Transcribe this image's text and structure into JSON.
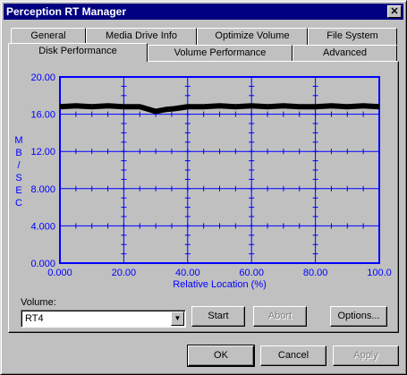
{
  "window": {
    "title": "Perception RT Manager",
    "close_glyph": "✕"
  },
  "tabs": {
    "back_row": [
      "General",
      "Media Drive Info",
      "Optimize Volume",
      "File System"
    ],
    "front_row": [
      "Disk Performance",
      "Volume Performance",
      "Advanced"
    ],
    "active": "Disk Performance"
  },
  "chart_data": {
    "type": "line",
    "xlabel": "Relative Location (%)",
    "ylabel": "MB/SEC",
    "xlim": [
      0,
      100
    ],
    "ylim": [
      0,
      20
    ],
    "x_ticks": [
      "0.000",
      "20.00",
      "40.00",
      "60.00",
      "80.00",
      "100.0"
    ],
    "y_ticks": [
      "0.000",
      "4.000",
      "8.000",
      "12.00",
      "16.00",
      "20.00"
    ],
    "series": [
      {
        "color": "#000000",
        "x": [
          0,
          5,
          10,
          15,
          20,
          25,
          28,
          30,
          33,
          36,
          40,
          45,
          50,
          55,
          60,
          65,
          70,
          75,
          80,
          85,
          90,
          95,
          100
        ],
        "y": [
          16.8,
          16.9,
          16.8,
          16.9,
          16.8,
          16.8,
          16.5,
          16.3,
          16.5,
          16.6,
          16.8,
          16.8,
          16.9,
          16.8,
          16.9,
          16.8,
          16.9,
          16.8,
          16.8,
          16.9,
          16.8,
          16.9,
          16.8
        ]
      }
    ],
    "grid": true,
    "colors": {
      "axis": "#0000ff",
      "plot_bg": "#c0c0c0"
    }
  },
  "volume": {
    "label": "Volume:",
    "value": "RT4",
    "dropdown_glyph": "▼"
  },
  "buttons": {
    "start": "Start",
    "abort": "Abort",
    "options": "Options...",
    "ok": "OK",
    "cancel": "Cancel",
    "apply": "Apply"
  }
}
